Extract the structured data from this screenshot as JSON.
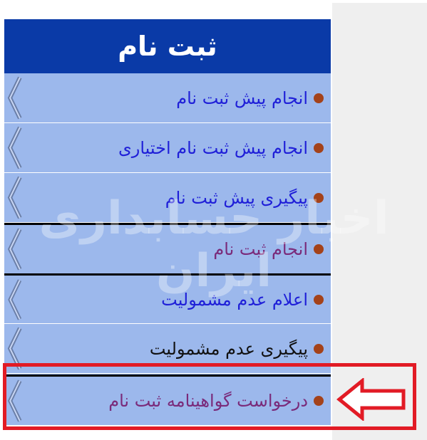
{
  "menu": {
    "title": "ثبت نام",
    "items": [
      {
        "label": "انجام پیش ثبت نام",
        "color": "#1f1fd8"
      },
      {
        "label": "انجام پیش ثبت نام اختیاری",
        "color": "#1f1fd8"
      },
      {
        "label": "پیگیری پیش ثبت نام",
        "color": "#1f1fd8"
      },
      {
        "label": "انجام ثبت نام",
        "color": "#7a2a7a"
      },
      {
        "label": "اعلام عدم مشمولیت",
        "color": "#1f1fd8"
      },
      {
        "label": "پیگیری عدم مشمولیت",
        "color": "#111111"
      },
      {
        "label": "درخواست گواهینامه ثبت نام",
        "color": "#7a2a7a"
      }
    ]
  },
  "watermark": "اخبار حسابداری ایران",
  "colors": {
    "header_bg": "#0a3aa7",
    "menu_bg": "#9cb8ec",
    "bullet": "#a4421a",
    "highlight": "#e21b25"
  },
  "icons": {
    "bullet": "bullet-dot-icon",
    "chevron": "chevron-left-icon",
    "pointer": "arrow-left-outline-icon"
  }
}
